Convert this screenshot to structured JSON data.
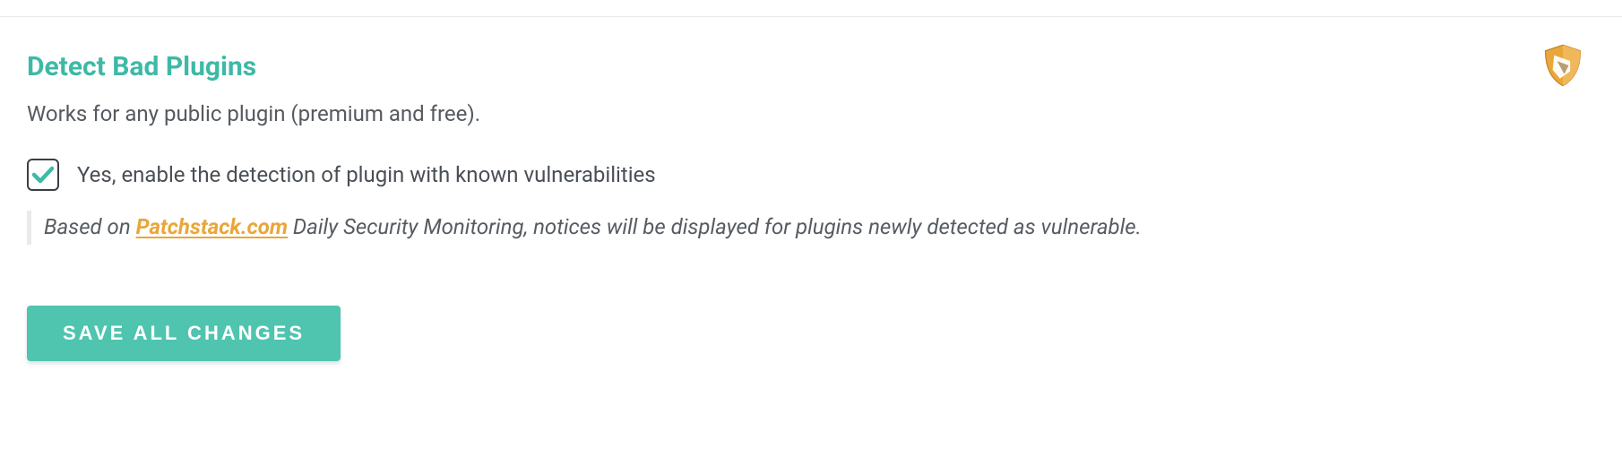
{
  "section": {
    "title": "Detect Bad Plugins",
    "subtitle": "Works for any public plugin (premium and free)."
  },
  "checkbox": {
    "checked": true,
    "label": "Yes, enable the detection of plugin with known vulnerabilities"
  },
  "info": {
    "prefix": "Based on ",
    "link_text": "Patchstack.com",
    "suffix": " Daily Security Monitoring, notices will be displayed for plugins newly detected as vulnerable."
  },
  "buttons": {
    "save": "SAVE ALL CHANGES"
  }
}
